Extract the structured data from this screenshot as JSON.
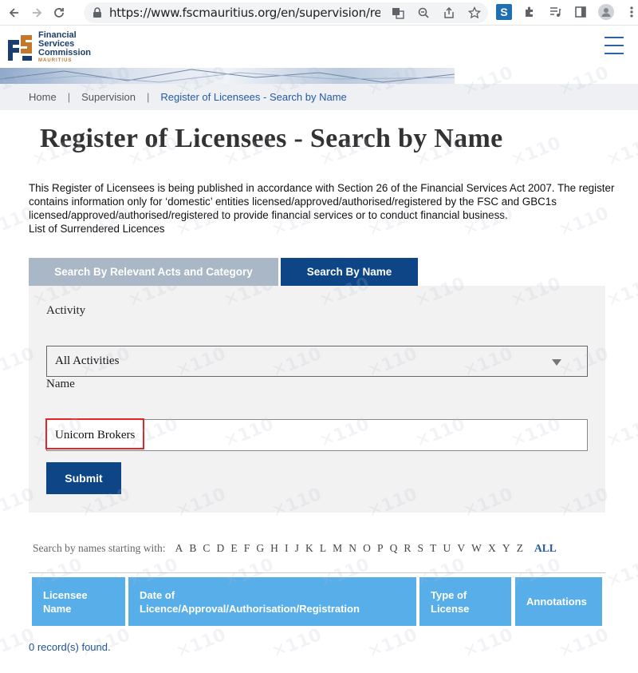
{
  "browser": {
    "url": "https://www.fscmauritius.org/en/supervision/regi...",
    "icons": [
      "back-icon",
      "forward-icon",
      "reload-icon",
      "lock-icon",
      "translate-icon",
      "zoom-icon",
      "share-icon",
      "star-icon",
      "extension-s-icon",
      "puzzle-icon",
      "media-icon",
      "sidepanel-icon",
      "profile-icon",
      "more-icon"
    ]
  },
  "logo": {
    "line1": "Financial",
    "line2": "Services",
    "line3": "Commission",
    "line4": "MAURITIUS"
  },
  "breadcrumb": {
    "home": "Home",
    "section": "Supervision",
    "current": "Register of Licensees - Search by Name"
  },
  "page": {
    "title": "Register of Licensees - Search by Name",
    "intro": "This Register of Licensees is being published in accordance with Section 26 of the Financial Services Act 2007. The register contains information only for ‘domestic’ entities licensed/approved/authorised/registered by the FSC and GBC1s licensed/approved/authorised/registered to provide financial services or to conduct financial business.",
    "surrendered_link": "List of Surrendered Licences"
  },
  "tabs": {
    "acts": "Search By Relevant Acts and Category",
    "name": "Search By Name"
  },
  "form": {
    "activity_label": "Activity",
    "activity_value": "All Activities",
    "name_label": "Name",
    "name_value": "Unicorn Brokers",
    "submit": "Submit"
  },
  "alphabet": {
    "label": "Search by names starting with:",
    "letters": [
      "A",
      "B",
      "C",
      "D",
      "E",
      "F",
      "G",
      "H",
      "I",
      "J",
      "K",
      "L",
      "M",
      "N",
      "O",
      "P",
      "Q",
      "R",
      "S",
      "T",
      "U",
      "V",
      "W",
      "X",
      "Y",
      "Z"
    ],
    "all": "ALL"
  },
  "table": {
    "headers": [
      "Licensee\nName",
      "Date of\nLicence/Approval/Authorisation/Registration",
      "Type of\nLicense",
      "Annotations"
    ],
    "records_text": "0 record(s) found."
  },
  "colors": {
    "primary": "#0d4586",
    "tab_inactive": "#a9b7c6",
    "table_header": "#58aee9",
    "highlight": "#e0252b"
  }
}
